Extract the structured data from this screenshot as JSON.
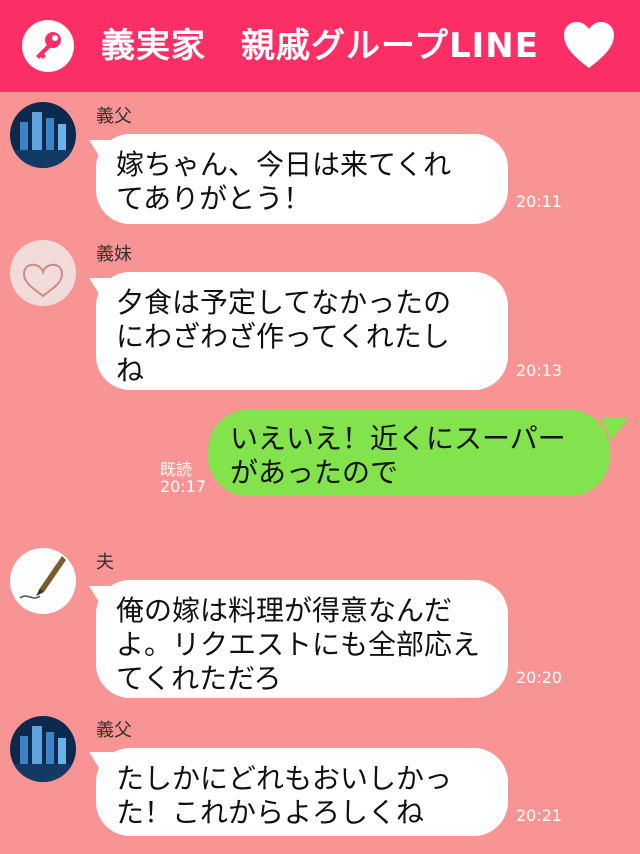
{
  "header": {
    "title": "義実家　親戚グループLINE",
    "left_icon": "key-icon",
    "right_icon": "heart-icon",
    "color": "#fb2f66"
  },
  "messages": [
    {
      "sender": "義父",
      "text": "嫁ちゃん、今日は来てくれ\nてありがとう！",
      "time": "20:11"
    },
    {
      "sender": "義妹",
      "text": "夕食は予定してなかったの\nにわざわざ作ってくれたし\nね",
      "time": "20:13"
    },
    {
      "sender": "me",
      "text": "いえいえ！近くにスーパー\nがあったので",
      "read": "既読",
      "time": "20:17"
    },
    {
      "sender": "夫",
      "text": "俺の嫁は料理が得意なんだ\nよ。リクエストにも全部応え\nてくれただろ",
      "time": "20:20"
    },
    {
      "sender": "義父",
      "text": "たしかにどれもおいしかっ\nた！これからよろしくね",
      "time": "20:21"
    }
  ],
  "colors": {
    "background": "#f99494",
    "my_bubble": "#82e34c",
    "other_bubble": "#ffffff"
  }
}
